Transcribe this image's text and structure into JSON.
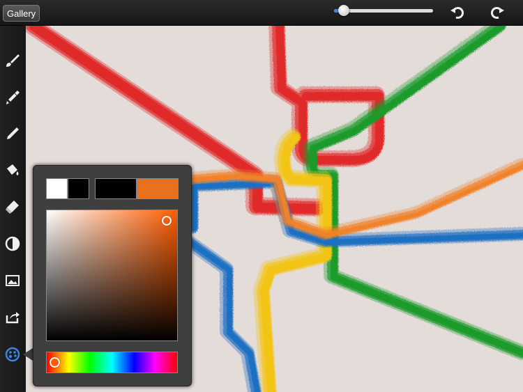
{
  "toolbar": {
    "gallery_label": "Gallery",
    "brush_size": 0.1,
    "undo_icon": "undo-icon",
    "redo_icon": "redo-icon",
    "accent_color": "#3b86e0"
  },
  "sidebar": {
    "tools": [
      {
        "name": "brush-icon"
      },
      {
        "name": "smudge-icon"
      },
      {
        "name": "pencil-icon"
      },
      {
        "name": "fill-bucket-icon"
      },
      {
        "name": "eraser-icon"
      },
      {
        "name": "layers-icon"
      },
      {
        "name": "image-icon"
      },
      {
        "name": "share-icon"
      },
      {
        "name": "color-palette-icon"
      }
    ]
  },
  "canvas": {
    "background": "#e4dcd9",
    "line_colors": [
      "#e02a2a",
      "#1a9a2a",
      "#f2c418",
      "#1e6fc2",
      "#f0822a"
    ]
  },
  "color_picker": {
    "primary_color": "#ffffff",
    "secondary_color": "#000000",
    "previous_color": "#000000",
    "current_color": "#e8711e",
    "hue_position": 0.06,
    "saturation": 0.92,
    "brightness": 0.92
  }
}
